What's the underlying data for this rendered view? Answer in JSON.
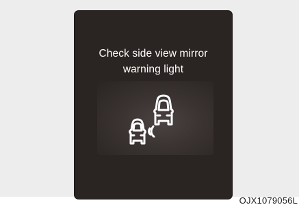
{
  "display": {
    "message_line1": "Check side view mirror",
    "message_line2": "warning light",
    "icon": "blind-spot-warning-icon"
  },
  "figure": {
    "code": "OJX1079056L"
  },
  "colors": {
    "page_background": "#ededed",
    "screen_background": "#2a2423",
    "text": "#ffffff"
  }
}
